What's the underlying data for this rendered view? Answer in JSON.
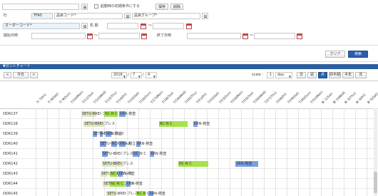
{
  "form": {
    "row1": {
      "checkbox_label": "起動時の初期条件にする",
      "save_label": "保存",
      "delete_label": "削除"
    },
    "row2": {
      "field1_label": "FJ",
      "field1_value": "TFA5",
      "field2_label": "品目コード*",
      "field3_label": "品目グループ*"
    },
    "row3": {
      "field1_label": "オーダーコード*",
      "field2_label": "机  期",
      "tilde": "～"
    },
    "row4": {
      "start_label": "開始日時",
      "end_label": "終了日時",
      "tilde": "～"
    },
    "clear_label": "クリア",
    "search_label": "検索"
  },
  "gantt": {
    "section_title": "▼ガントチャート",
    "prev_label": "<",
    "today_label": "今日",
    "next_label": ">",
    "year": "2018",
    "month": "7",
    "day": "4",
    "scale_label": "scale :",
    "scale_value": "1",
    "scale_unit": "day",
    "views": [
      "日",
      "週",
      "月",
      "四半期",
      "半年",
      "年"
    ],
    "active_view": 2,
    "dates": [
      "7/ 7(Fri)",
      "7/ 8(Sat)",
      "7/ 9(Sun)",
      "7/10(Mon)",
      "7/11(Tue)",
      "7/12(Wed)",
      "7/13(Thu)",
      "7/14(Fri)",
      "7/15(Sat)",
      "7/16(Sun)",
      "7/17(Mon)",
      "7/18(Tue)",
      "7/19(Wed)",
      "7/20(Thu)",
      "7/21(Fri)",
      "7/22(Sat)",
      "7/23(Sun)",
      "7/24(Mon)",
      "7/25(Tue)",
      "7/26(Wed)",
      "7/27(Thu)",
      "7/28(Fri)",
      "7/29(Sat)",
      "7/30(Sun)",
      "7/31(Mon)",
      "8/ 1(Tue)",
      "8/ 2(Wed)",
      "8/ 3(Thu)",
      "8/ 4(Fri)",
      "8/ 5(Sat)"
    ],
    "rows": [
      {
        "label": "ODR137",
        "bars": [
          {
            "text": "SETU-BREI-プレス",
            "start": 4.0,
            "len": 1.3,
            "color": "#dfe7c4"
          },
          {
            "text": "NC-N C",
            "start": 6.0,
            "len": 1.2,
            "color": "#a6e24a"
          },
          {
            "text": "XRN-検査",
            "start": 7.3,
            "len": 0.6,
            "color": "#7aa0e0"
          }
        ]
      },
      {
        "label": "ODR128",
        "bars": [
          {
            "text": "SETU-BREI-プレス",
            "start": 4.2,
            "len": 1.8,
            "color": "#dfe7c4"
          },
          {
            "text": "NC-N C",
            "start": 10.8,
            "len": 2.5,
            "color": "#a6e24a"
          },
          {
            "text": "XRN-検査",
            "start": 13.8,
            "len": 0.4,
            "color": "#7aa0e0"
          }
        ]
      },
      {
        "label": "ODR139",
        "bars": [
          {
            "text": "SETU-BREI-プレス",
            "start": 5.0,
            "len": 0.4,
            "color": "#7aa0e0"
          },
          {
            "text": "NC-N C",
            "start": 5.6,
            "len": 0.3,
            "color": "#7aa0e0"
          },
          {
            "text": "XRN-検査",
            "start": 6.1,
            "len": 0.5,
            "color": "#7aa0e0"
          }
        ]
      },
      {
        "label": "ODR140",
        "bars": [
          {
            "text": "SETU-BREI-プレス",
            "start": 5.6,
            "len": 0.6,
            "color": "#7aa0e0"
          },
          {
            "text": "NC-N C",
            "start": 6.6,
            "len": 0.5,
            "color": "#7aa0e0"
          },
          {
            "text": "XRN-組立",
            "start": 7.3,
            "len": 0.6,
            "color": "#7aa0e0"
          },
          {
            "text": "XRN-検査",
            "start": 8.8,
            "len": 0.4,
            "color": "#7aa0e0"
          }
        ]
      },
      {
        "label": "ODR141",
        "bars": [
          {
            "text": "SETU-BREI-プレス",
            "start": 5.8,
            "len": 0.5,
            "color": "#7aa0e0"
          },
          {
            "text": "NC-N C",
            "start": 8.5,
            "len": 0.6,
            "color": "#7aa0e0"
          },
          {
            "text": "XRN-検査",
            "start": 10.0,
            "len": 0.4,
            "color": "#7aa0e0"
          }
        ]
      },
      {
        "label": "ODR142",
        "bars": [
          {
            "text": "SETU-BREI-プレス",
            "start": 5.8,
            "len": 1.9,
            "color": "#dfe7c4"
          },
          {
            "text": "NC-N C",
            "start": 12.5,
            "len": 2.6,
            "color": "#a6e24a"
          },
          {
            "text": "XRN-検査",
            "start": 17.5,
            "len": 2.0,
            "color": "#7aa0e0"
          }
        ]
      },
      {
        "label": "ODR143",
        "bars": [
          {
            "text": "SETU-BREI-プレス",
            "start": 5.7,
            "len": 0.6,
            "color": "#dfe7c4"
          },
          {
            "text": "NC-N C",
            "start": 6.5,
            "len": 0.6,
            "color": "#a6e24a"
          },
          {
            "text": "XRN-検査",
            "start": 7.2,
            "len": 0.4,
            "color": "#7aa0e0"
          }
        ]
      },
      {
        "label": "ODR144",
        "bars": [
          {
            "text": "SETU-BREI-プレス",
            "start": 5.9,
            "len": 0.6,
            "color": "#dfe7c4"
          },
          {
            "text": "NC-N C",
            "start": 6.5,
            "len": 1.3,
            "color": "#a6e24a"
          },
          {
            "text": "XRN-検査",
            "start": 7.9,
            "len": 0.4,
            "color": "#7aa0e0"
          }
        ]
      },
      {
        "label": "ODR145",
        "bars": [
          {
            "text": "SETU-BREI-プレス",
            "start": 6.2,
            "len": 0.8,
            "color": "#dfe7c4"
          },
          {
            "text": "NC-N C",
            "start": 8.8,
            "len": 0.8,
            "color": "#a6e24a"
          },
          {
            "text": "XRN-検査",
            "start": 9.9,
            "len": 0.4,
            "color": "#7aa0e0"
          }
        ]
      }
    ]
  }
}
